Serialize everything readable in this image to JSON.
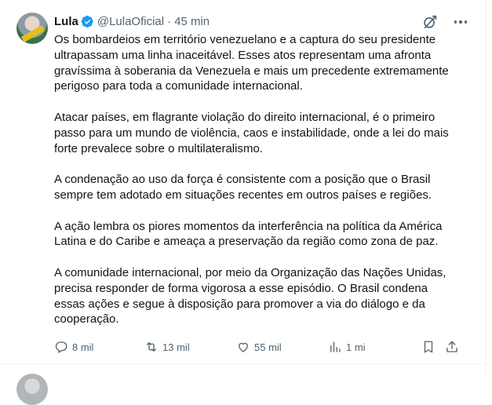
{
  "tweet": {
    "author_name": "Lula",
    "handle": "@LulaOficial",
    "separator": "·",
    "time": "45 min",
    "paragraphs": [
      "Os bombardeios em território venezuelano e a captura do seu presidente\nultrapassam uma linha inaceitável. Esses atos representam uma afronta\ngravíssima à soberania da Venezuela e mais um precedente extremamente\nperigoso para toda a comunidade internacional.",
      "Atacar países, em flagrante violação do direito internacional, é o primeiro\npasso para um mundo de violência, caos e instabilidade, onde a lei do mais\nforte prevalece sobre o multilateralismo.",
      "A condenação ao uso da força é consistente com a posição que o Brasil\nsempre tem adotado em situações recentes em outros países e regiões.",
      "A ação lembra os piores momentos da interferência na política da América\nLatina e do Caribe e ameaça a preservação da região como zona de paz.",
      "A comunidade internacional, por meio da Organização das Nações Unidas,\nprecisa responder de forma vigorosa a esse episódio. O Brasil condena\nessas ações e segue à disposição para promover a via do diálogo e da\ncooperação."
    ],
    "actions": {
      "replies": "8 mil",
      "reposts": "13 mil",
      "likes": "55 mil",
      "views": "1 mi"
    }
  },
  "colors": {
    "text": "#0f1419",
    "muted": "#536471",
    "verified": "#1d9bf0",
    "border": "#eff3f4"
  }
}
